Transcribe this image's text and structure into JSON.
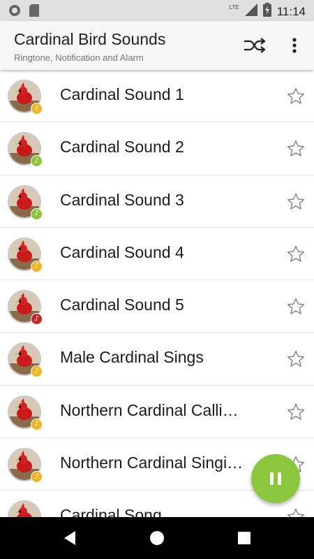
{
  "status_bar": {
    "time": "11:14",
    "network": "LTE",
    "icons": [
      "record-icon",
      "sd-card-icon",
      "signal-icon",
      "battery-charging-icon"
    ]
  },
  "app_bar": {
    "title": "Cardinal Bird Sounds",
    "subtitle": "Ringtone, Notification and Alarm",
    "actions": [
      "shuffle-icon",
      "more-vert-icon"
    ]
  },
  "sounds": [
    {
      "title": "Cardinal Sound 1",
      "badge_color": "#f0b429",
      "favorite": false
    },
    {
      "title": "Cardinal Sound 2",
      "badge_color": "#8cc63f",
      "favorite": false
    },
    {
      "title": "Cardinal Sound 3",
      "badge_color": "#8cc63f",
      "favorite": false
    },
    {
      "title": "Cardinal Sound 4",
      "badge_color": "#f0b429",
      "favorite": false
    },
    {
      "title": "Cardinal Sound 5",
      "badge_color": "#c62828",
      "favorite": false
    },
    {
      "title": "Male Cardinal Sings",
      "badge_color": "#f0b429",
      "favorite": false
    },
    {
      "title": "Northern Cardinal Calli…",
      "badge_color": "#f0b429",
      "favorite": false
    },
    {
      "title": "Northern Cardinal Singi…",
      "badge_color": "#f0b429",
      "favorite": false
    },
    {
      "title": "Cardinal Song",
      "badge_color": "#f0b429",
      "favorite": false
    }
  ],
  "fab": {
    "icon": "pause-icon",
    "color": "#8cc63f"
  },
  "nav_bar": {
    "icons": [
      "back-icon",
      "home-icon",
      "recents-icon"
    ]
  },
  "colors": {
    "accent": "#8cc63f",
    "note_yellow": "#f0b429",
    "note_green": "#8cc63f",
    "note_red": "#c62828"
  }
}
